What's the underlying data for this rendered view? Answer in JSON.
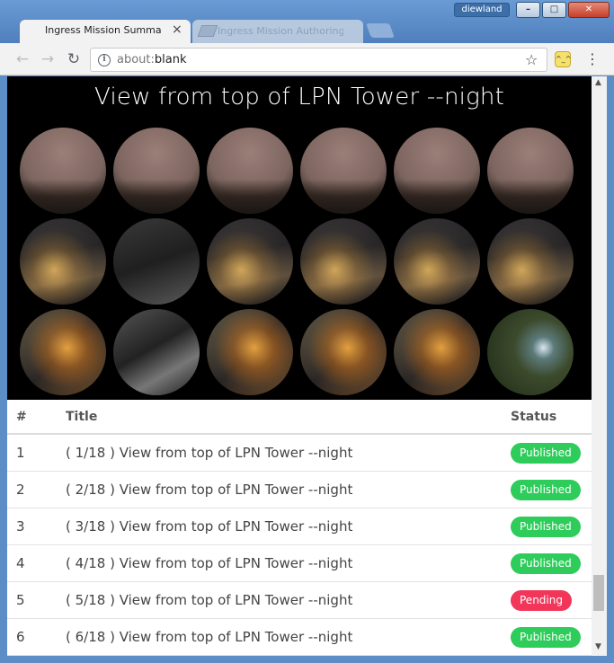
{
  "window": {
    "user": "diewland",
    "controls": {
      "minimize": "–",
      "maximize": "□",
      "close": "✕"
    }
  },
  "tabs": [
    {
      "title": "Ingress Mission Summary",
      "active": true
    },
    {
      "title": "Ingress Mission Authoring",
      "active": false
    }
  ],
  "toolbar": {
    "url_scheme": "about:",
    "url_path": "blank",
    "icons": [
      "back-icon",
      "forward-icon",
      "reload-icon",
      "info-icon",
      "star-icon",
      "extension-icon",
      "menu-icon"
    ]
  },
  "banner": {
    "title": "View from top of LPN Tower --night",
    "tile_count": 18,
    "rows": 3,
    "cols": 6
  },
  "table": {
    "headers": {
      "num": "#",
      "title": "Title",
      "status": "Status"
    },
    "rows": [
      {
        "num": "1",
        "title": "( 1/18 ) View from top of LPN Tower --night",
        "status": "Published"
      },
      {
        "num": "2",
        "title": "( 2/18 ) View from top of LPN Tower --night",
        "status": "Published"
      },
      {
        "num": "3",
        "title": "( 3/18 ) View from top of LPN Tower --night",
        "status": "Published"
      },
      {
        "num": "4",
        "title": "( 4/18 ) View from top of LPN Tower --night",
        "status": "Published"
      },
      {
        "num": "5",
        "title": "( 5/18 ) View from top of LPN Tower --night",
        "status": "Pending"
      },
      {
        "num": "6",
        "title": "( 6/18 ) View from top of LPN Tower --night",
        "status": "Published"
      }
    ]
  },
  "colors": {
    "published": "#2ecc5a",
    "pending": "#f2365a",
    "banner_bg": "#000000"
  }
}
